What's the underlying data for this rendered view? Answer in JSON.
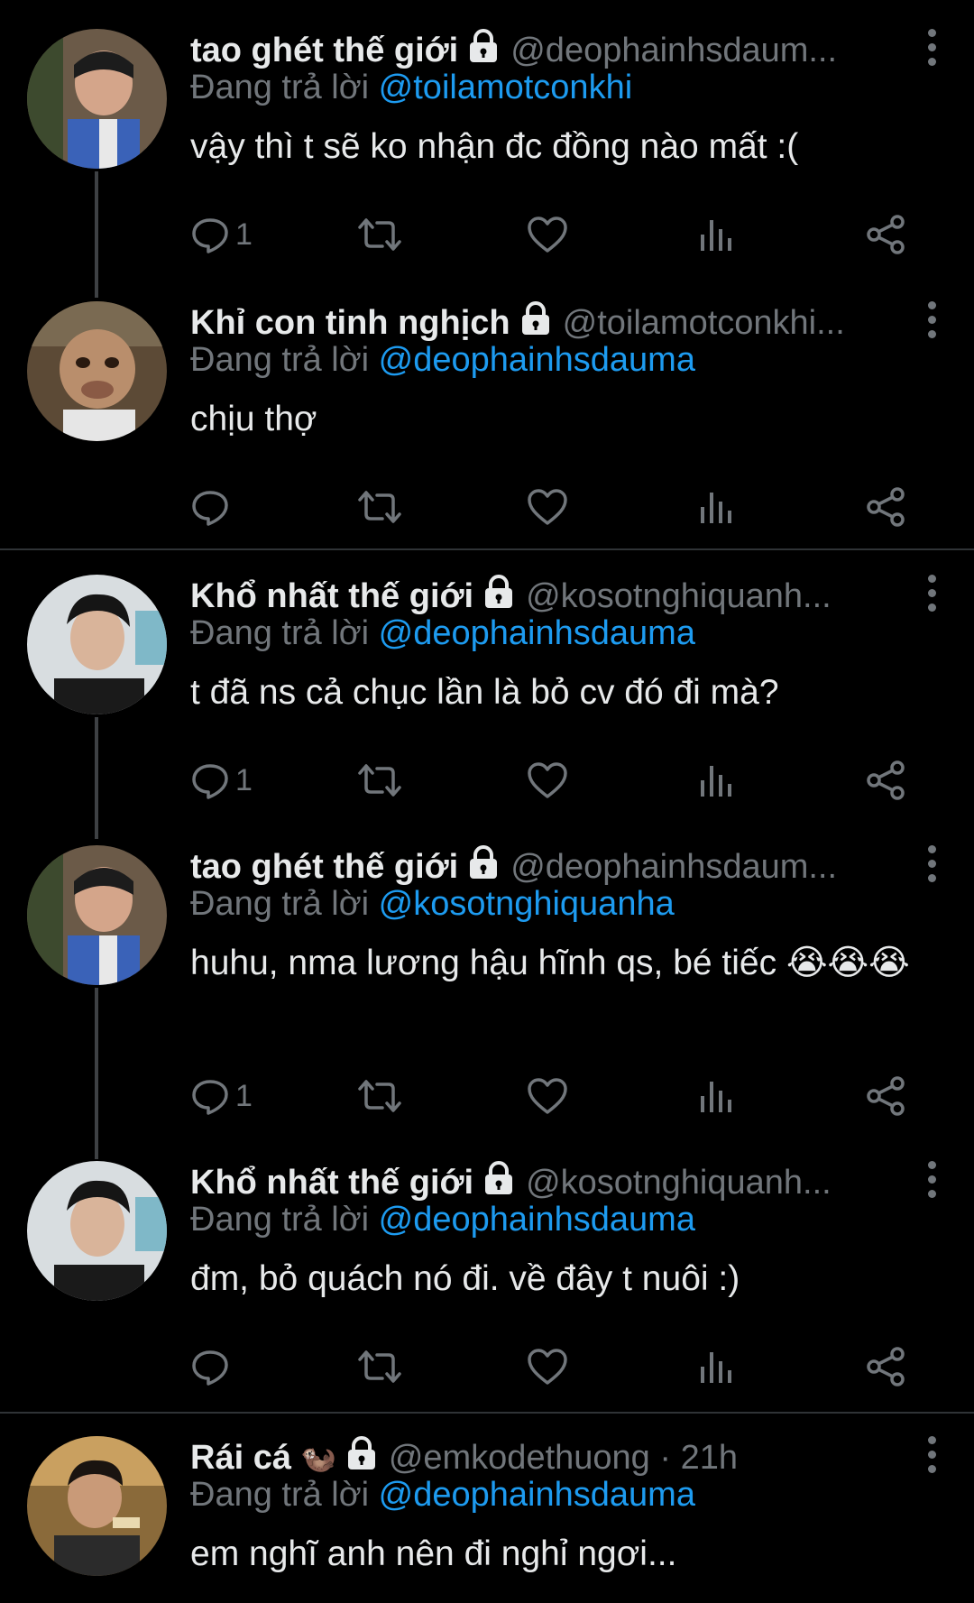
{
  "tweets": [
    {
      "name": "tao ghét thế giới",
      "handle": "@deophainhsdaum...",
      "replying_prefix": "Đang trả lời ",
      "replying_to": "@toilamotconkhi",
      "text": "vậy thì t sẽ ko nhận đc đồng nào mất :(",
      "reply_count": "1",
      "avatar_icon": "child-avatar-icon"
    },
    {
      "name": "Khỉ con tinh nghịch",
      "handle": "@toilamotconkhi...",
      "replying_prefix": "Đang trả lời ",
      "replying_to": "@deophainhsdauma",
      "text": "chịu thợ",
      "reply_count": "",
      "avatar_icon": "monkey-avatar-icon"
    },
    {
      "name": "Khổ nhất thế giới",
      "handle": "@kosotnghiquanh...",
      "replying_prefix": "Đang trả lời ",
      "replying_to": "@deophainhsdauma",
      "text": "t đã ns cả chục lần là bỏ cv đó đi mà?",
      "reply_count": "1",
      "avatar_icon": "young-man-avatar-icon"
    },
    {
      "name": "tao ghét thế giới",
      "handle": "@deophainhsdaum...",
      "replying_prefix": "Đang trả lời ",
      "replying_to": "@kosotnghiquanha",
      "text": "huhu, nma lương hậu hĩnh qs, bé tiếc 😭😭😭",
      "reply_count": "1",
      "avatar_icon": "child-avatar-icon"
    },
    {
      "name": "Khổ nhất thế giới",
      "handle": "@kosotnghiquanh...",
      "replying_prefix": "Đang trả lời ",
      "replying_to": "@deophainhsdauma",
      "text": "đm, bỏ quách nó đi. về đây t nuôi :)",
      "reply_count": "",
      "avatar_icon": "young-man-avatar-icon"
    },
    {
      "name": "Rái cá",
      "name_emoji": "🦦",
      "handle": "@emkodethuong · 21h",
      "replying_prefix": "Đang trả lời ",
      "replying_to": "@deophainhsdauma",
      "text": "em nghĩ anh nên đi nghỉ ngơi...",
      "reply_count": "",
      "avatar_icon": "man-eating-avatar-icon"
    }
  ],
  "icons": {
    "reply": "reply-icon",
    "retweet": "retweet-icon",
    "like": "like-icon",
    "views": "views-icon",
    "share": "share-icon",
    "more": "more-icon",
    "lock": "lock-icon"
  },
  "colors": {
    "background": "#000000",
    "text": "#e7e9ea",
    "muted": "#71767b",
    "link": "#1d9bf0",
    "divider": "#2f3336"
  }
}
